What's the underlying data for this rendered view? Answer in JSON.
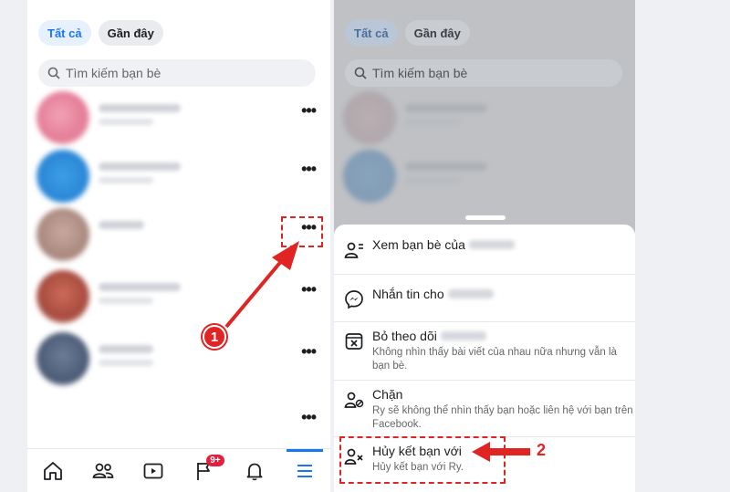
{
  "friends_screen": {
    "tabs": [
      {
        "label": "Tất cả",
        "active": true
      },
      {
        "label": "Gần đây",
        "active": false
      }
    ],
    "search": {
      "placeholder": "Tìm kiếm bạn bè"
    },
    "more_button_label": "•••",
    "friend_rows": 6
  },
  "bottom_nav": {
    "items": [
      {
        "name": "home-icon"
      },
      {
        "name": "friends-icon"
      },
      {
        "name": "watch-icon"
      },
      {
        "name": "pages-flag-icon",
        "badge": "9+"
      },
      {
        "name": "notifications-bell-icon"
      },
      {
        "name": "menu-icon",
        "active": true
      }
    ]
  },
  "action_sheet": {
    "options": [
      {
        "title": "Xem bạn bè của",
        "desc": "",
        "icon": "view-friends-icon"
      },
      {
        "title": "Nhắn tin cho",
        "desc": "",
        "icon": "messenger-icon"
      },
      {
        "title": "Bỏ theo dõi",
        "desc": "Không nhìn thấy bài viết của nhau nữa nhưng vẫn là bạn bè.",
        "icon": "unfollow-icon"
      },
      {
        "title": "Chặn",
        "desc": "Ry sẽ không thể nhìn thấy bạn hoặc liên hệ với bạn trên Facebook.",
        "icon": "block-icon"
      },
      {
        "title": "Hủy kết bạn với",
        "desc": "Hủy kết bạn với Ry.",
        "icon": "unfriend-icon"
      }
    ]
  },
  "annotations": {
    "step1": "1",
    "step2": "2"
  },
  "colors": {
    "accent": "#1877f2",
    "annotation_red": "#e02424",
    "badge_red": "#e41e3f"
  }
}
